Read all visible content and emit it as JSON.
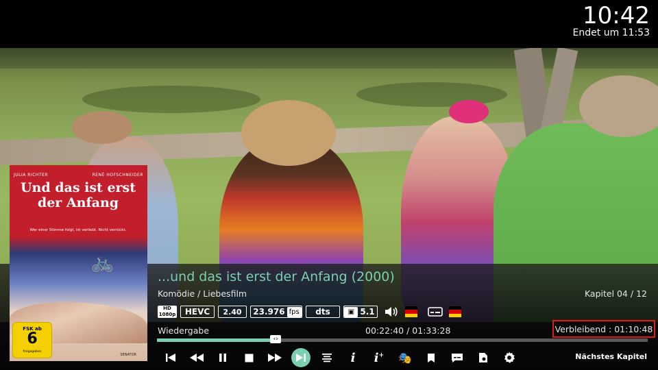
{
  "clock": {
    "time": "10:42",
    "ends_at": "Endet um 11:53"
  },
  "poster": {
    "cast_left": "JULIA RICHTER",
    "cast_right": "RENÉ HOFSCHNEIDER",
    "title": "Und das ist erst der Anfang",
    "tagline": "Wer einer Stimme folgt, ist verliebt. Nicht verrückt.",
    "studio": "SENATOR",
    "rating": {
      "top": "FSK ab",
      "number": "6",
      "bottom": "freigegeben"
    }
  },
  "info": {
    "title": "...und das ist erst der Anfang (2000)",
    "genre": "Komödie / Liebesfilm",
    "chapter": "Kapitel 04 / 12"
  },
  "media_flags": {
    "resolution": "HD 1080p",
    "codec": "HEVC",
    "aspect": "2.40",
    "fps_value": "23.976",
    "fps_unit": "fps",
    "audio_codec": "dts",
    "channels": "5.1"
  },
  "playback": {
    "status": "Wiedergabe",
    "time": "00:22:40 / 01:33:28",
    "remaining": "Verbleibend : 01:10:48",
    "progress_fraction": 0.242,
    "next_label": "Nächstes Kapitel"
  },
  "controls": [
    "previous-icon",
    "rewind-icon",
    "pause-icon",
    "stop-icon",
    "fast-forward-icon",
    "next-chapter-icon",
    "playlist-icon",
    "info-icon",
    "extended-info-icon",
    "theater-masks-icon",
    "bookmark-icon",
    "subtitles-icon",
    "video-settings-icon",
    "settings-gear-icon"
  ],
  "colors": {
    "accent": "#7ad0b0",
    "highlight_border": "#e01a1a"
  }
}
